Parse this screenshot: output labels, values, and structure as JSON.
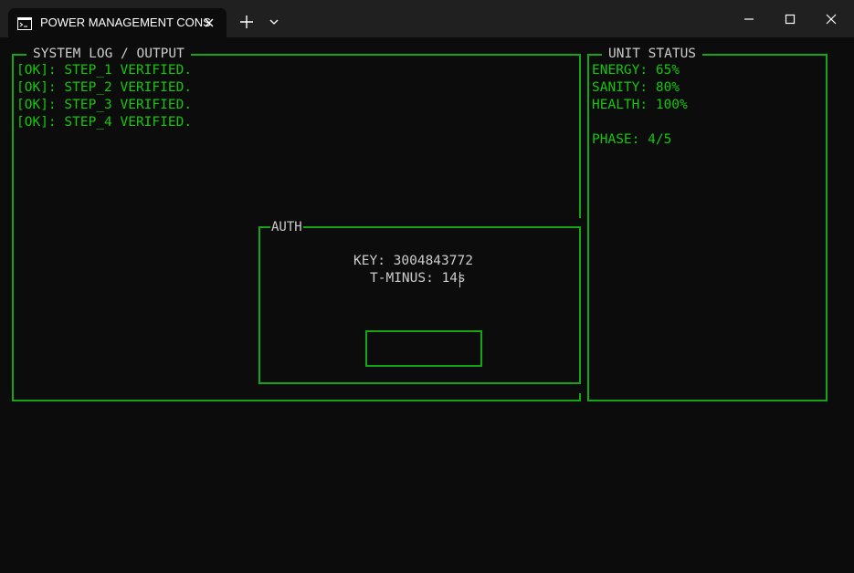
{
  "window": {
    "tab_title": "POWER MANAGEMENT CONS",
    "tab_icon": "terminal-icon",
    "close_tab_icon": "close-icon",
    "new_tab_icon": "plus-icon",
    "dropdown_icon": "chevron-down-icon",
    "minimize_icon": "minimize-icon",
    "maximize_icon": "maximize-icon",
    "close_window_icon": "close-icon"
  },
  "log": {
    "title": "SYSTEM LOG / OUTPUT",
    "lines": [
      "[OK]: STEP_1 VERIFIED.",
      "[OK]: STEP_2 VERIFIED.",
      "[OK]: STEP_3 VERIFIED.",
      "[OK]: STEP_4 VERIFIED."
    ]
  },
  "status": {
    "title": "UNIT STATUS",
    "energy": "ENERGY: 65%",
    "sanity": "SANITY: 80%",
    "health": "HEALTH: 100%",
    "phase": "PHASE: 4/5"
  },
  "auth": {
    "title": "AUTH",
    "key": "KEY: 3004843772",
    "tminus": "T-MINUS: 14s",
    "input_value": ""
  },
  "colors": {
    "background": "#0c0c0c",
    "titlebar": "#202020",
    "border_green": "#16a516",
    "text_green": "#16c60c",
    "text_grey": "#cccccc"
  }
}
